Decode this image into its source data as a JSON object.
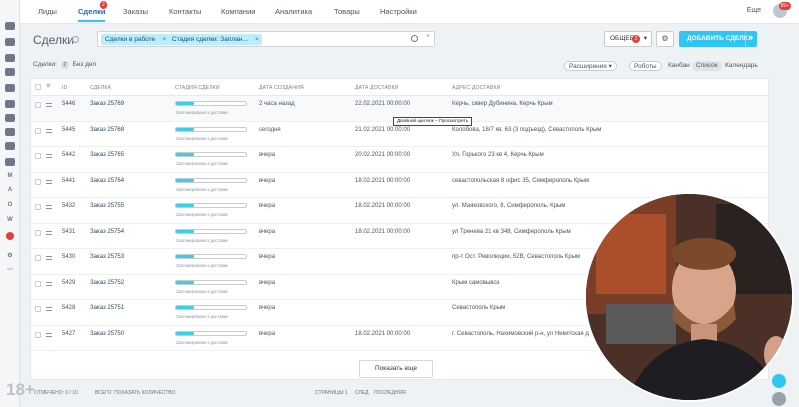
{
  "nav": {
    "tabs": [
      "Лиды",
      "Сделки",
      "Заказы",
      "Контакты",
      "Компании",
      "Аналитика",
      "Товары",
      "Настройки"
    ],
    "active_tab": "Сделки",
    "deals_badge": "2",
    "more_label": "Еще",
    "notif_badge": "99+"
  },
  "toolbar": {
    "title": "Сделки",
    "filter_chips": [
      "Сделки в работе",
      "Стадия сделки: Заплан..."
    ],
    "chip_close": "×",
    "clear_glyph": "×",
    "common_label": "ОБЩЕЕ",
    "common_count": "2",
    "add_label": "ДОБАВИТЬ СДЕЛКУ",
    "gear_glyph": "⚙",
    "dropdown_glyph": "▾"
  },
  "subbar": {
    "deals_label": "Сделки:",
    "deals_count": "2",
    "no_deals_label": "Без дел",
    "extensions_label": "Расширения",
    "robots_label": "Роботы",
    "views": [
      "Канбан",
      "Список",
      "Календарь"
    ],
    "selected_view": "Список"
  },
  "grid": {
    "headers": [
      "ID",
      "СДЕЛКА",
      "СТАДИЯ СДЕЛКИ",
      "ДАТА СОЗДАНИЯ",
      "ДАТА ДОСТАВКИ",
      "АДРЕС ДОСТАВКИ"
    ],
    "settings_glyph": "⚙",
    "stage_label": "Запланировано к доставке",
    "stage_progress": 0.25,
    "rows": [
      {
        "id": "5446",
        "deal": "Заказ 25769",
        "created": "2 часа назад",
        "delivery": "22.02.2021 00:00:00",
        "address": "Керчь, сквер Дубинина, Керчь Крым"
      },
      {
        "id": "5445",
        "deal": "Заказ 25768",
        "created": "сегодня",
        "delivery": "21.02.2021 00:00:00",
        "address": "Колобова, 18/7 кв. 63 (3 подъезд), Севастополь Крым"
      },
      {
        "id": "5442",
        "deal": "Заказ 25765",
        "created": "вчера",
        "delivery": "20.02.2021 00:00:00",
        "address": "Ул. Горького 23 кв 4, Керчь Крым"
      },
      {
        "id": "5441",
        "deal": "Заказ 25764",
        "created": "вчера",
        "delivery": "18.02.2021 00:00:00",
        "address": "севастопольская 8 офис 35, Симферополь Крым"
      },
      {
        "id": "5432",
        "deal": "Заказ 25755",
        "created": "вчера",
        "delivery": "18.02.2021 00:00:00",
        "address": "ул. Маяковского, 8, Симферополь, Крым"
      },
      {
        "id": "5431",
        "deal": "Заказ 25754",
        "created": "вчера",
        "delivery": "18.02.2021 00:00:00",
        "address": "ул Тренева 21 кв 348, Симферополь Крым"
      },
      {
        "id": "5430",
        "deal": "Заказ 25753",
        "created": "вчера",
        "delivery": "",
        "address": "пр-т Ост. Революции, 52В, Севастополь Крым"
      },
      {
        "id": "5429",
        "deal": "Заказ 25752",
        "created": "вчера",
        "delivery": "",
        "address": "Крым самовывоз"
      },
      {
        "id": "5428",
        "deal": "Заказ 25751",
        "created": "вчера",
        "delivery": "",
        "address": "Севастополь Крым"
      },
      {
        "id": "5427",
        "deal": "Заказ 25750",
        "created": "вчера",
        "delivery": "18.02.2021 00:00:00",
        "address": "г. Севастополь, Нахимовский р-н, ул Никитская д 11, 01"
      }
    ]
  },
  "tooltip": "Двойной щелчок – Просмотреть",
  "show_more": "Показать еще",
  "footer": {
    "selected": "ОТМЕЧЕНО: 0 / 10",
    "total": "ВСЕГО: ПОКАЗАТЬ КОЛИЧЕСТВО",
    "pages": "СТРАНИЦЫ:",
    "page_num": "1",
    "next": "СЛЕД.",
    "last": "ПОСЛЕДНЯЯ"
  },
  "age_rating": "18+",
  "colors": {
    "accent": "#2fc6f6",
    "progress": "#3ccde9",
    "badge": "#e0403a",
    "link": "#2067b0"
  }
}
